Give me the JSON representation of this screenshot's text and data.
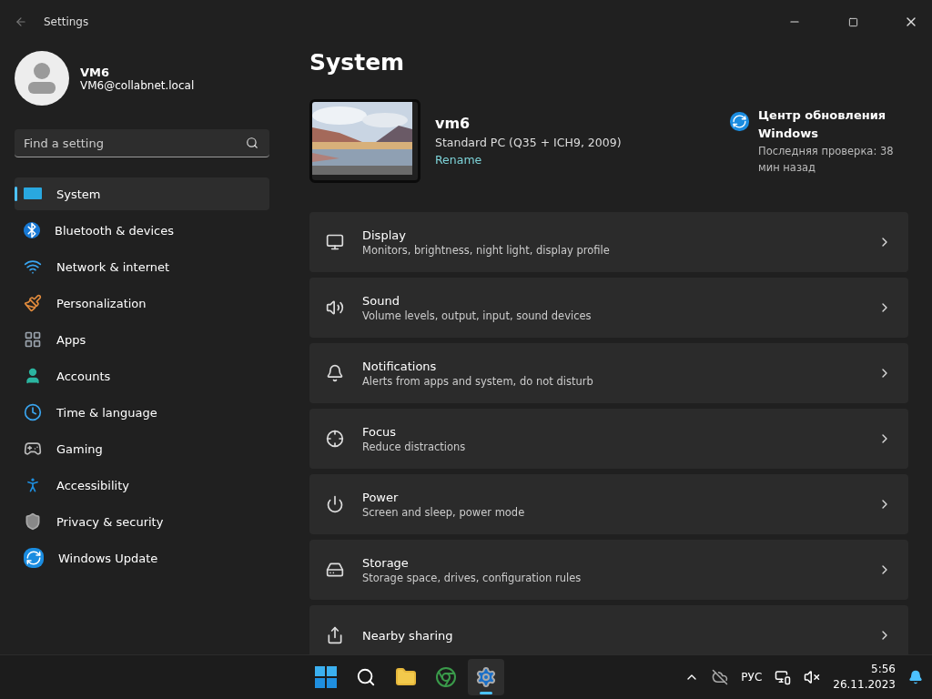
{
  "window": {
    "title": "Settings"
  },
  "account": {
    "name": "VM6",
    "email": "VM6@collabnet.local"
  },
  "search": {
    "placeholder": "Find a setting"
  },
  "nav": [
    {
      "label": "System",
      "selected": true
    },
    {
      "label": "Bluetooth & devices",
      "selected": false
    },
    {
      "label": "Network & internet",
      "selected": false
    },
    {
      "label": "Personalization",
      "selected": false
    },
    {
      "label": "Apps",
      "selected": false
    },
    {
      "label": "Accounts",
      "selected": false
    },
    {
      "label": "Time & language",
      "selected": false
    },
    {
      "label": "Gaming",
      "selected": false
    },
    {
      "label": "Accessibility",
      "selected": false
    },
    {
      "label": "Privacy & security",
      "selected": false
    },
    {
      "label": "Windows Update",
      "selected": false
    }
  ],
  "page": {
    "title": "System"
  },
  "device": {
    "name": "vm6",
    "model": "Standard PC (Q35 + ICH9, 2009)",
    "rename": "Rename"
  },
  "update": {
    "title": "Центр обновления Windows",
    "status": "Последняя проверка: 38 мин назад"
  },
  "settings": [
    {
      "title": "Display",
      "subtitle": "Monitors, brightness, night light, display profile"
    },
    {
      "title": "Sound",
      "subtitle": "Volume levels, output, input, sound devices"
    },
    {
      "title": "Notifications",
      "subtitle": "Alerts from apps and system, do not disturb"
    },
    {
      "title": "Focus",
      "subtitle": "Reduce distractions"
    },
    {
      "title": "Power",
      "subtitle": "Screen and sleep, power mode"
    },
    {
      "title": "Storage",
      "subtitle": "Storage space, drives, configuration rules"
    },
    {
      "title": "Nearby sharing"
    }
  ],
  "taskbar": {
    "apps": [
      {
        "selected": false
      },
      {
        "selected": false
      },
      {
        "selected": false
      },
      {
        "selected": false
      },
      {
        "selected": true
      }
    ],
    "language": "РУС",
    "time": "5:56",
    "date": "26.11.2023"
  }
}
